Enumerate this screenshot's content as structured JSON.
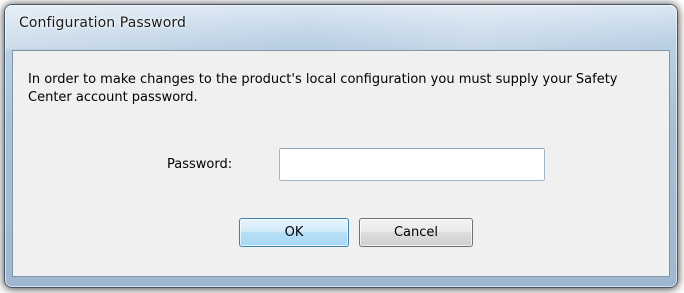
{
  "dialog": {
    "title": "Configuration Password",
    "message": "In order to make changes to the product's local configuration you must supply your Safety Center account password.",
    "password_label": "Password:",
    "password_value": "",
    "ok_label": "OK",
    "cancel_label": "Cancel"
  },
  "colors": {
    "titlebar": "#c4d7e9",
    "client_background": "#f0f0f0",
    "default_button": "#b7dff7",
    "default_button_border": "#3c7fb1"
  }
}
